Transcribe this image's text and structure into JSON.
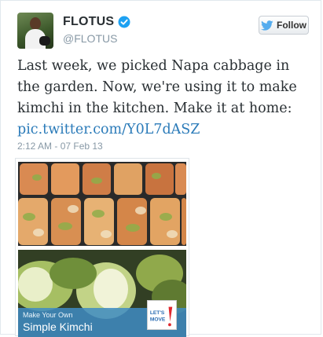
{
  "tweet": {
    "display_name": "FLOTUS",
    "handle": "@FLOTUS",
    "follow_label": "Follow",
    "text": "Last week, we picked Napa cabbage in the garden. Now, we're using it to make kimchi in the kitchen. Make it at home:",
    "link_text": "pic.twitter.com/Y0L7dASZ",
    "timestamp": "2:12 AM - 07 Feb 13"
  },
  "media": {
    "banner_line1": "Make Your Own",
    "banner_line2": "Simple Kimchi",
    "badge_text": "LET'S MOVE!"
  },
  "colors": {
    "link": "#2b7bb9",
    "verified": "#1da1f2",
    "banner": "#408cc4",
    "text": "#292f33",
    "muted": "#8899a6"
  },
  "icons": {
    "verified": "verified-badge-icon",
    "follow": "twitter-bird-icon"
  }
}
